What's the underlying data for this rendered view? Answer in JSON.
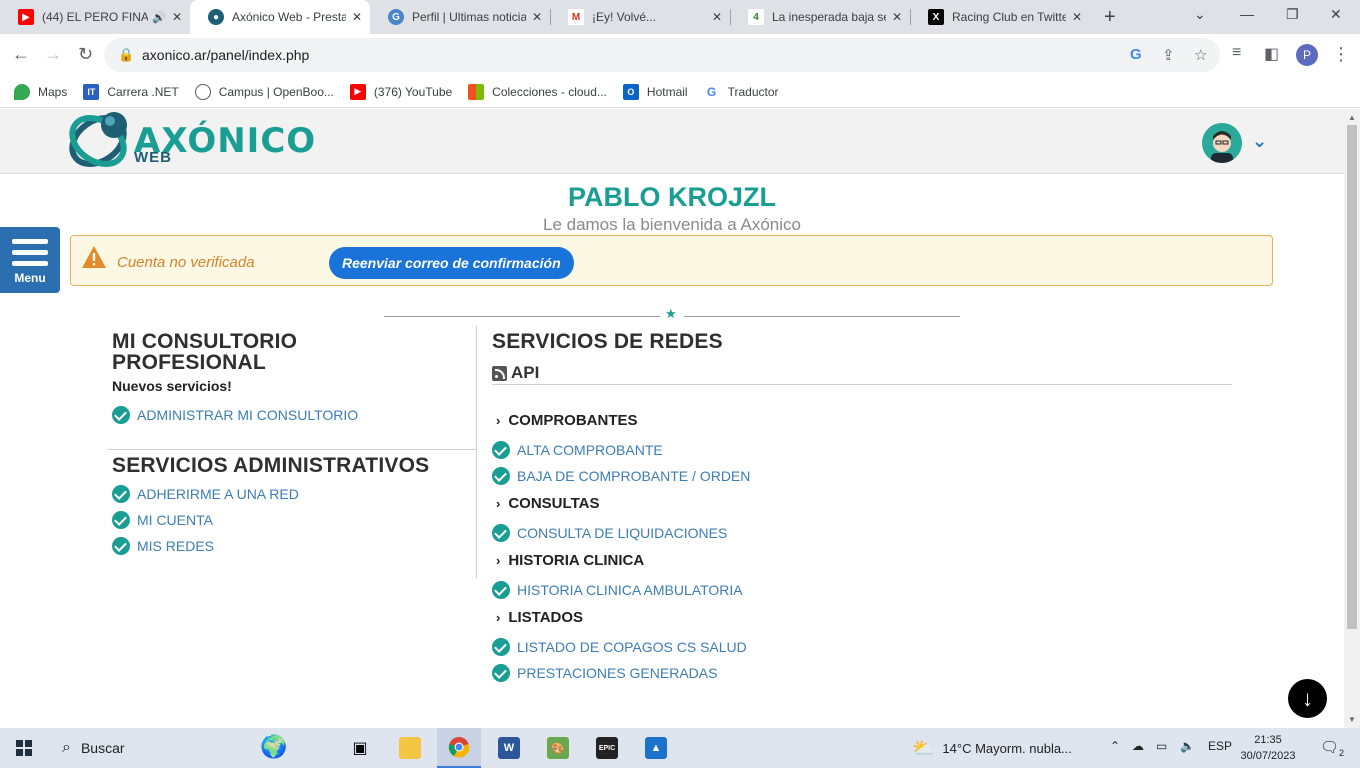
{
  "browser": {
    "tabs": [
      {
        "title": "(44) EL PERO FINA",
        "icon": "youtube-icon",
        "color": "#ff0000",
        "audio": true
      },
      {
        "title": "Axónico Web - Presta",
        "icon": "axonico-icon",
        "color": "#1f5f73",
        "active": true
      },
      {
        "title": "Perfil | Ultimas noticia",
        "icon": "perfil-icon",
        "color": "#4a86c5"
      },
      {
        "title": "¡Ey! Volvé...",
        "icon": "gmail-icon",
        "color": "#d93025"
      },
      {
        "title": "La inesperada baja se",
        "icon": "ole-icon",
        "color": "#2e7d32"
      },
      {
        "title": "Racing Club en Twitte",
        "icon": "x-icon",
        "color": "#000000"
      }
    ],
    "new_tab": "+",
    "url": "axonico.ar/panel/index.php",
    "profile_initial": "P",
    "bookmarks": [
      {
        "label": "Maps",
        "icon": "maps-icon",
        "color": "#34a853"
      },
      {
        "label": "Carrera .NET",
        "icon": "dotnet-icon",
        "color": "#2b5fc2"
      },
      {
        "label": "Campus | OpenBoo...",
        "icon": "globe-icon",
        "color": "#555555"
      },
      {
        "label": "(376) YouTube",
        "icon": "youtube-icon",
        "color": "#ff0000"
      },
      {
        "label": "Colecciones - cloud...",
        "icon": "microsoft-icon",
        "color": "#f25022"
      },
      {
        "label": "Hotmail",
        "icon": "outlook-icon",
        "color": "#0a64c8"
      },
      {
        "label": "Traductor",
        "icon": "google-icon",
        "color": "#4285f4"
      }
    ]
  },
  "site": {
    "logo_text": "AXÓNICO",
    "logo_sub": "WEB",
    "user_name": "PABLO KROJZL",
    "welcome": "Le damos la bienvenida a Axónico",
    "menu_label": "Menu",
    "alert": {
      "message": "Cuenta no verificada",
      "button": "Reenviar correo de confirmación"
    }
  },
  "left_column": {
    "consultorio": {
      "title": "MI CONSULTORIO PROFESIONAL",
      "subtitle": "Nuevos servicios!",
      "items": [
        "ADMINISTRAR MI CONSULTORIO"
      ]
    },
    "administrativos": {
      "title": "SERVICIOS ADMINISTRATIVOS",
      "items": [
        "ADHERIRME A UNA RED",
        "MI CUENTA",
        "MIS REDES"
      ]
    }
  },
  "right_column": {
    "title": "SERVICIOS DE REDES",
    "api_label": "API",
    "groups": [
      {
        "title": "COMPROBANTES",
        "items": [
          "ALTA COMPROBANTE",
          "BAJA DE COMPROBANTE / ORDEN"
        ]
      },
      {
        "title": "CONSULTAS",
        "items": [
          "CONSULTA DE LIQUIDACIONES"
        ]
      },
      {
        "title": "HISTORIA CLINICA",
        "items": [
          "HISTORIA CLINICA AMBULATORIA"
        ]
      },
      {
        "title": "LISTADOS",
        "items": [
          "LISTADO DE COPAGOS CS SALUD",
          "PRESTACIONES GENERADAS"
        ]
      }
    ]
  },
  "taskbar": {
    "search_placeholder": "Buscar",
    "weather": "14°C  Mayorm. nubla...",
    "language": "ESP",
    "time": "21:35",
    "date": "30/07/2023",
    "notifications": "2"
  },
  "colors": {
    "accent": "#1a9e94",
    "link": "#3d7db5",
    "menu": "#2c6fb1",
    "alert_bg": "#fcf8e3",
    "button": "#1a73d9"
  }
}
